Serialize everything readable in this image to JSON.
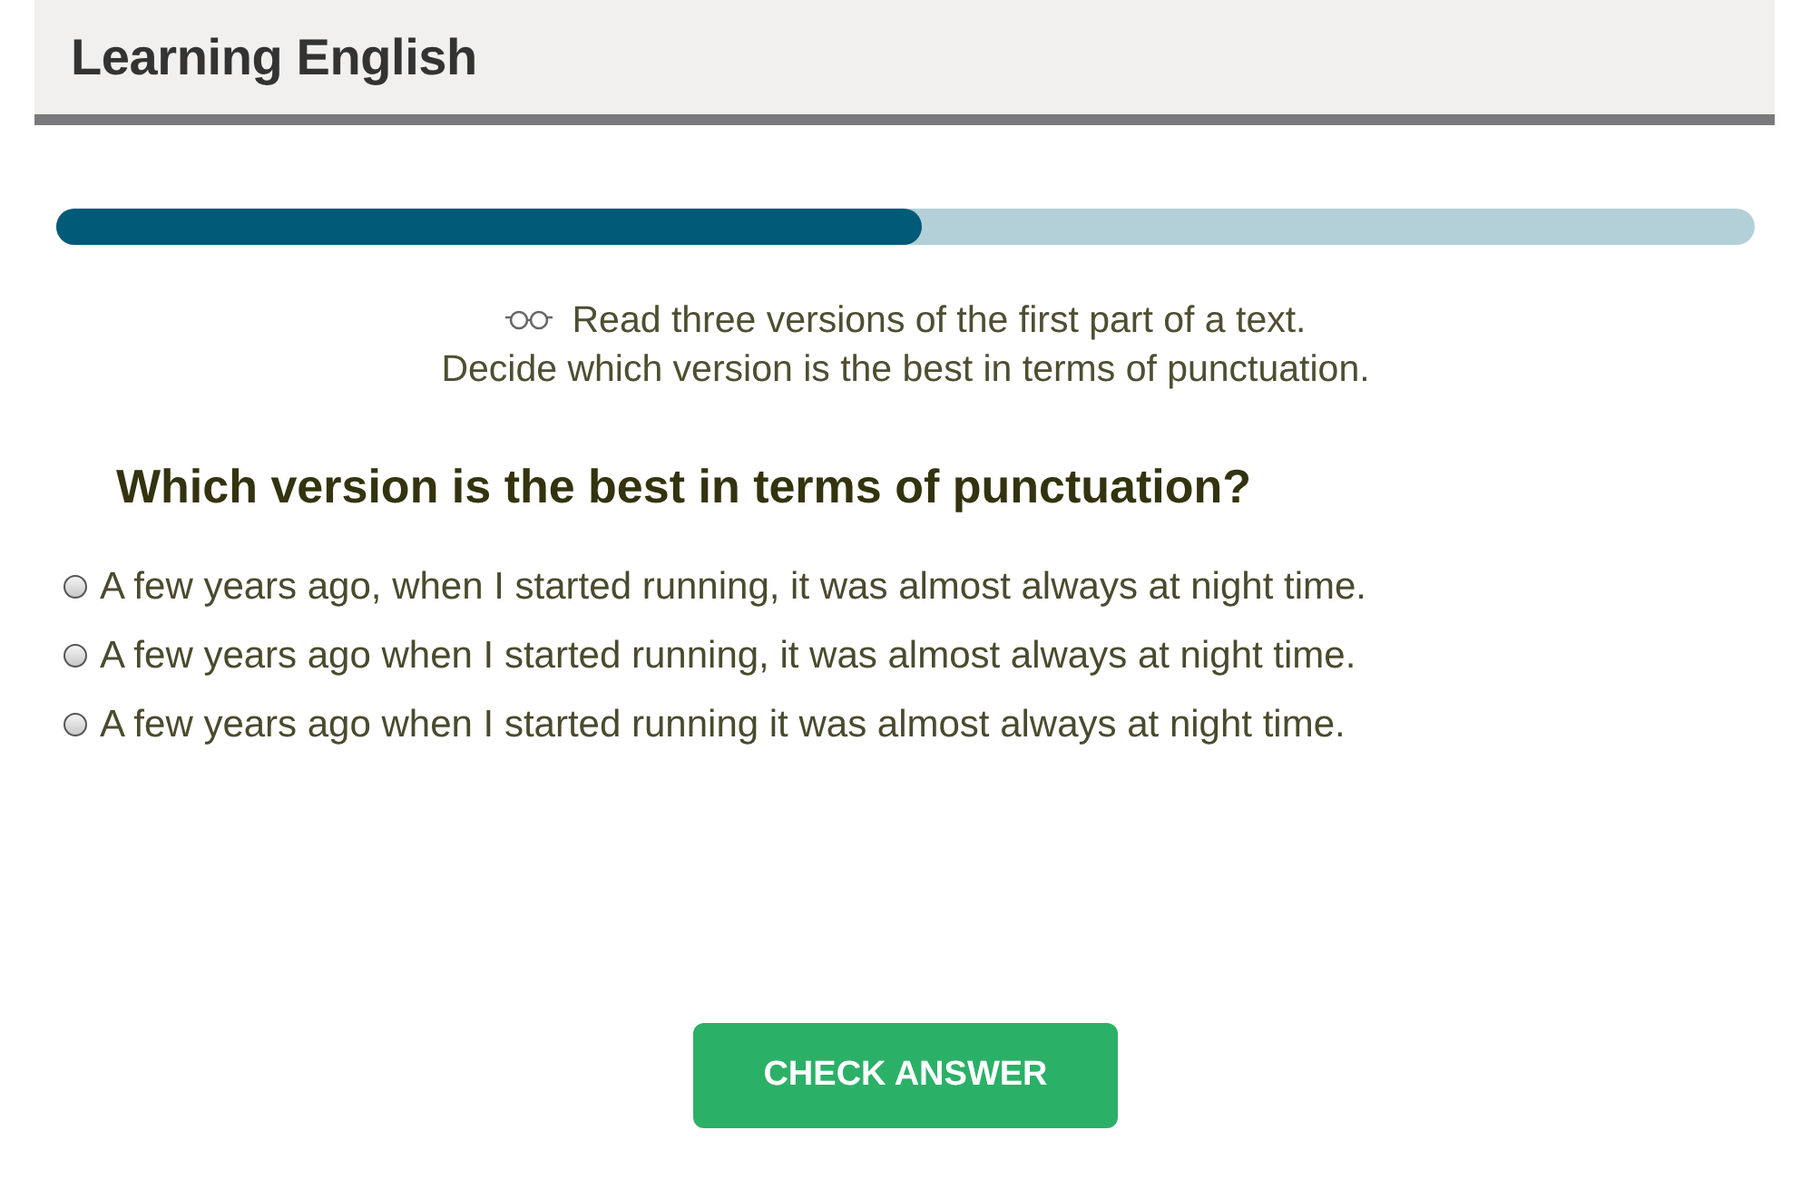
{
  "header": {
    "title": "Learning English"
  },
  "progress": {
    "level": 0.51
  },
  "instructions": [
    "Read three versions of the first part of a text.",
    "Decide which version is the best in terms of punctuation."
  ],
  "question": "Which version is the best in terms of punctuation?",
  "options": [
    {
      "label": "A few years ago, when I started running, it was almost always at night time.",
      "selected": false
    },
    {
      "label": "A few years ago when I started running, it was almost always at night time.",
      "selected": false
    },
    {
      "label": "A few years ago when I started running it was almost always at night time.",
      "selected": false
    }
  ],
  "buttons": [
    {
      "label": "CHECK ANSWER"
    }
  ]
}
